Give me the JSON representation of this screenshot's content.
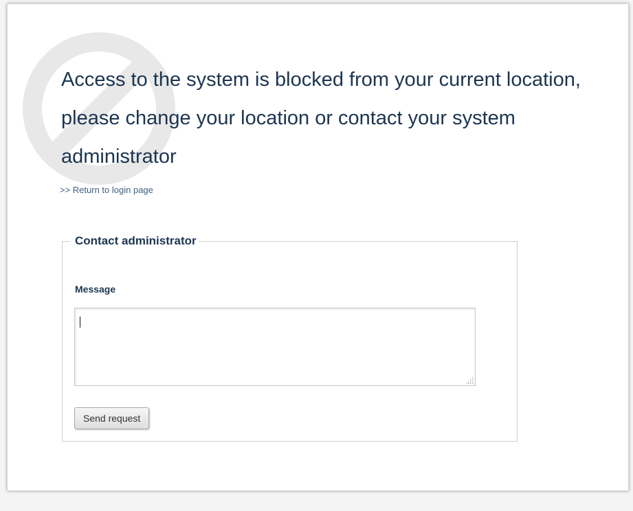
{
  "page": {
    "headline": "Access to the system is blocked from your current location, please change your location or contact your system administrator",
    "return_link": ">> Return to login page"
  },
  "contact": {
    "legend": "Contact administrator",
    "message_label": "Message",
    "message_value": "",
    "send_button": "Send request"
  },
  "icons": {
    "background_icon": "blocked-icon",
    "textarea_resize": "resize-grip-icon"
  },
  "colors": {
    "text_primary": "#1c3550",
    "link": "#3f5f84",
    "icon": "#e8e8e8"
  }
}
